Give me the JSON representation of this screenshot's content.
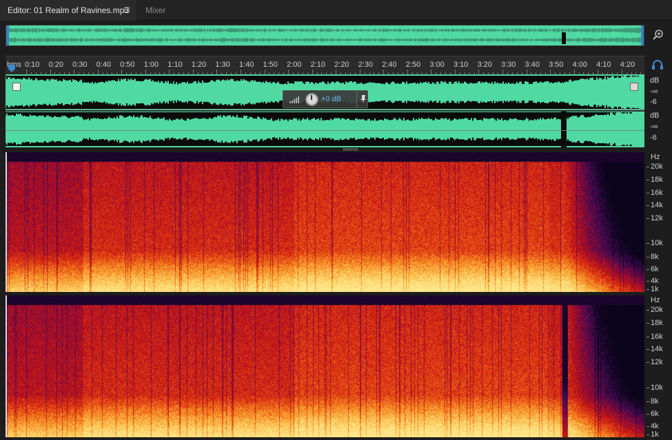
{
  "tabs": {
    "editor": "Editor: 01 Realm of Ravines.mp3",
    "mixer": "Mixer"
  },
  "ruler": {
    "unit": "hms",
    "labels": [
      "0:10",
      "0:20",
      "0:30",
      "0:40",
      "0:50",
      "1:00",
      "1:10",
      "1:20",
      "1:30",
      "1:40",
      "1:50",
      "2:00",
      "2:10",
      "2:20",
      "2:30",
      "2:40",
      "2:50",
      "3:00",
      "3:10",
      "3:20",
      "3:30",
      "3:40",
      "3:50",
      "4:00",
      "4:10",
      "4:20"
    ]
  },
  "waveform": {
    "db_label": "dB",
    "neg_inf": "-∞",
    "minus6": "-6"
  },
  "hud": {
    "gain": "+0 dB"
  },
  "spectral": {
    "hz_label": "Hz",
    "freq_labels": [
      "20k",
      "18k",
      "16k",
      "14k",
      "12k",
      "10k",
      "8k",
      "6k",
      "4k",
      "1k"
    ]
  },
  "colors": {
    "waveform_fill": "#50d9a3",
    "accent": "#6fb1ea",
    "spectral_low": "#ffd36a",
    "spectral_high": "#2a0a3a"
  },
  "icons": {
    "tab_menu": "hamburger-icon",
    "zoom": "zoom-in-icon",
    "playhead": "playhead-icon",
    "monitor": "headphones-icon",
    "hud_meter": "level-bars-icon",
    "hud_knob": "gain-knob-icon",
    "hud_pin": "pin-icon"
  }
}
